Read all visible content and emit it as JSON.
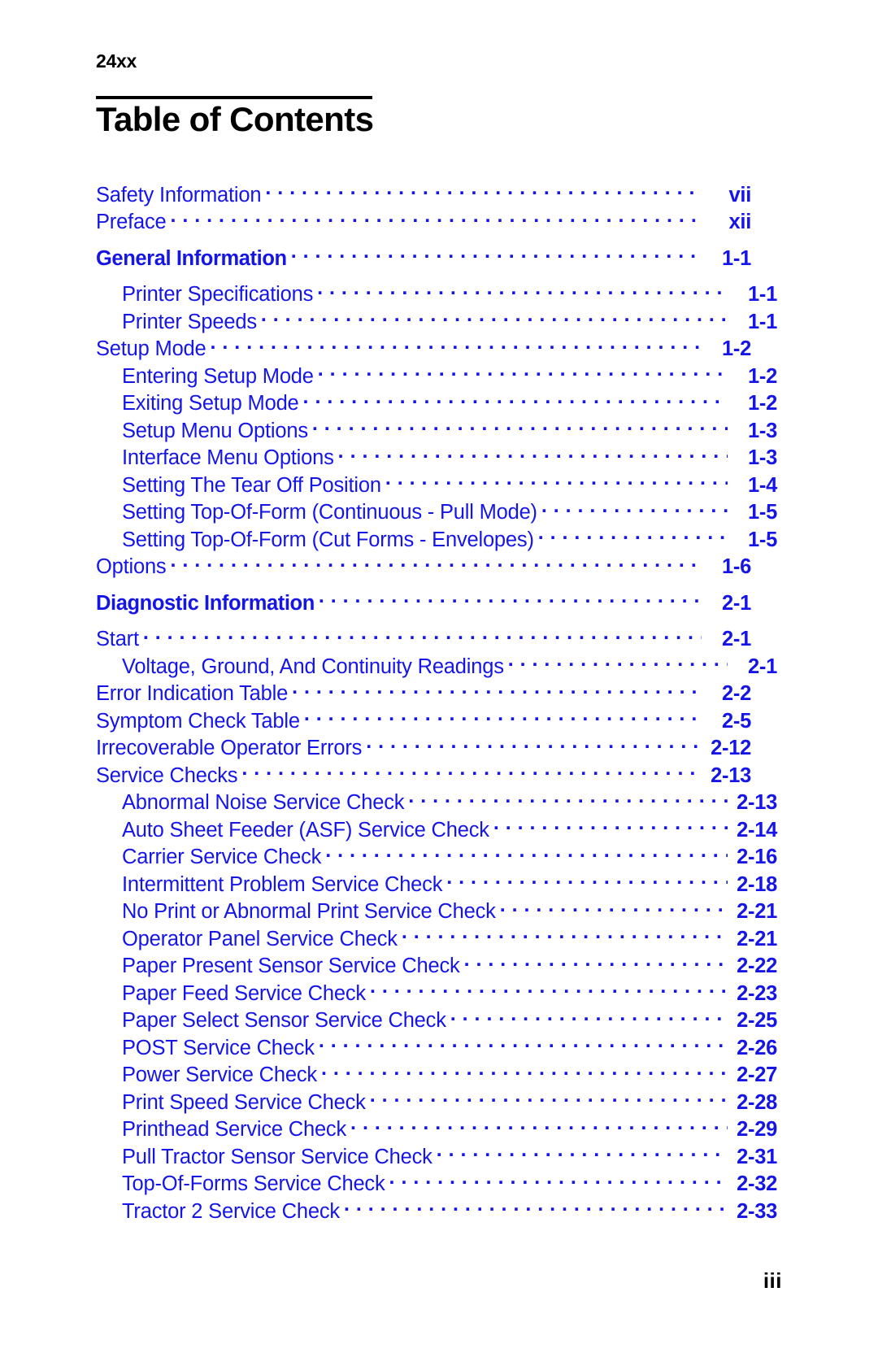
{
  "header": {
    "running_head": "24xx"
  },
  "title": {
    "text": "Table of Contents"
  },
  "footer": {
    "folio": "iii"
  },
  "colors": {
    "entry_blue": "#1515E8",
    "text_black": "#000000",
    "page_background": "#FFFFFF"
  },
  "toc": {
    "entries": [
      {
        "label": "Safety Information",
        "page": "vii",
        "level": 1,
        "style": "normal",
        "spacing": "none"
      },
      {
        "label": "Preface",
        "page": "xii",
        "level": 1,
        "style": "normal",
        "spacing": "none"
      },
      {
        "label": "General Information",
        "page": "1-1",
        "level": 1,
        "style": "chapter",
        "spacing": "both"
      },
      {
        "label": "Printer Specifications",
        "page": "1-1",
        "level": 2,
        "style": "normal",
        "spacing": "none"
      },
      {
        "label": "Printer Speeds",
        "page": "1-1",
        "level": 2,
        "style": "normal",
        "spacing": "none"
      },
      {
        "label": "Setup Mode",
        "page": "1-2",
        "level": 1,
        "style": "normal",
        "spacing": "none"
      },
      {
        "label": "Entering Setup Mode",
        "page": "1-2",
        "level": 2,
        "style": "normal",
        "spacing": "none"
      },
      {
        "label": "Exiting Setup Mode",
        "page": "1-2",
        "level": 2,
        "style": "normal",
        "spacing": "none"
      },
      {
        "label": "Setup Menu Options",
        "page": "1-3",
        "level": 2,
        "style": "normal",
        "spacing": "none"
      },
      {
        "label": "Interface Menu Options",
        "page": "1-3",
        "level": 2,
        "style": "normal",
        "spacing": "none"
      },
      {
        "label": "Setting The Tear Off Position",
        "page": "1-4",
        "level": 2,
        "style": "normal",
        "spacing": "none"
      },
      {
        "label": "Setting Top-Of-Form (Continuous - Pull Mode)",
        "page": "1-5",
        "level": 2,
        "style": "normal",
        "spacing": "none"
      },
      {
        "label": "Setting Top-Of-Form (Cut Forms - Envelopes)",
        "page": "1-5",
        "level": 2,
        "style": "normal",
        "spacing": "none"
      },
      {
        "label": "Options",
        "page": "1-6",
        "level": 1,
        "style": "normal",
        "spacing": "none"
      },
      {
        "label": "Diagnostic Information",
        "page": "2-1",
        "level": 1,
        "style": "chapter",
        "spacing": "both"
      },
      {
        "label": "Start",
        "page": "2-1",
        "level": 1,
        "style": "normal",
        "spacing": "none"
      },
      {
        "label": "Voltage, Ground, And Continuity Readings",
        "page": "2-1",
        "level": 2,
        "style": "normal",
        "spacing": "none"
      },
      {
        "label": "Error Indication Table",
        "page": "2-2",
        "level": 1,
        "style": "normal",
        "spacing": "none"
      },
      {
        "label": "Symptom Check Table",
        "page": "2-5",
        "level": 1,
        "style": "normal",
        "spacing": "none"
      },
      {
        "label": "Irrecoverable Operator Errors",
        "page": "2-12",
        "level": 1,
        "style": "normal",
        "spacing": "none"
      },
      {
        "label": "Service Checks",
        "page": "2-13",
        "level": 1,
        "style": "normal",
        "spacing": "none"
      },
      {
        "label": "Abnormal Noise Service Check",
        "page": "2-13",
        "level": 2,
        "style": "normal",
        "spacing": "none"
      },
      {
        "label": "Auto Sheet Feeder (ASF) Service Check",
        "page": "2-14",
        "level": 2,
        "style": "normal",
        "spacing": "none"
      },
      {
        "label": "Carrier Service Check",
        "page": "2-16",
        "level": 2,
        "style": "normal",
        "spacing": "none"
      },
      {
        "label": "Intermittent Problem Service Check",
        "page": "2-18",
        "level": 2,
        "style": "normal",
        "spacing": "none"
      },
      {
        "label": "No Print or Abnormal Print Service Check",
        "page": "2-21",
        "level": 2,
        "style": "normal",
        "spacing": "none"
      },
      {
        "label": "Operator Panel Service Check",
        "page": "2-21",
        "level": 2,
        "style": "normal",
        "spacing": "none"
      },
      {
        "label": "Paper Present Sensor Service Check",
        "page": "2-22",
        "level": 2,
        "style": "normal",
        "spacing": "none"
      },
      {
        "label": "Paper Feed Service Check",
        "page": "2-23",
        "level": 2,
        "style": "normal",
        "spacing": "none"
      },
      {
        "label": "Paper Select Sensor Service Check",
        "page": "2-25",
        "level": 2,
        "style": "normal",
        "spacing": "none"
      },
      {
        "label": "POST Service Check",
        "page": "2-26",
        "level": 2,
        "style": "normal",
        "spacing": "none"
      },
      {
        "label": "Power Service Check",
        "page": "2-27",
        "level": 2,
        "style": "normal",
        "spacing": "none"
      },
      {
        "label": "Print Speed Service Check",
        "page": "2-28",
        "level": 2,
        "style": "normal",
        "spacing": "none"
      },
      {
        "label": "Printhead Service Check",
        "page": "2-29",
        "level": 2,
        "style": "normal",
        "spacing": "none"
      },
      {
        "label": "Pull Tractor Sensor Service Check",
        "page": "2-31",
        "level": 2,
        "style": "normal",
        "spacing": "none"
      },
      {
        "label": "Top-Of-Forms Service Check",
        "page": "2-32",
        "level": 2,
        "style": "normal",
        "spacing": "none"
      },
      {
        "label": "Tractor 2 Service Check",
        "page": "2-33",
        "level": 2,
        "style": "normal",
        "spacing": "none"
      }
    ]
  }
}
